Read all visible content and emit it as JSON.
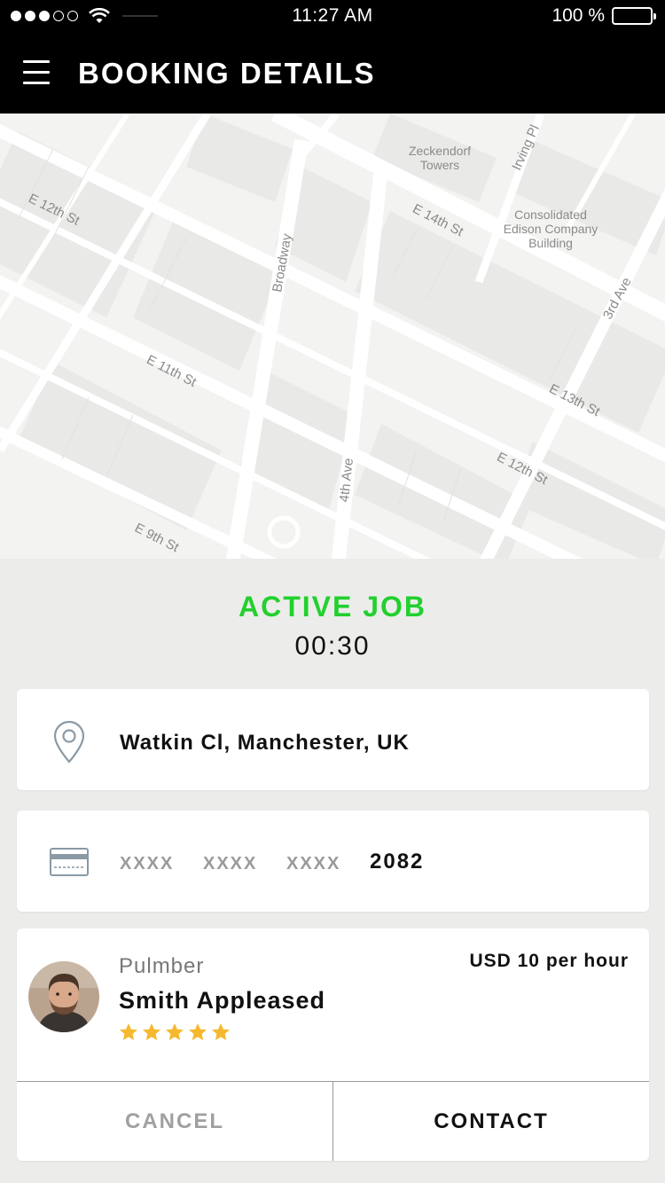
{
  "status_bar": {
    "time": "11:27 AM",
    "battery": "100 %",
    "battery_level": 1.0,
    "signal_bars_filled": 3,
    "signal_bars_total": 5
  },
  "header": {
    "title": "BOOKING DETAILS",
    "menu_icon": "hamburger-menu-icon"
  },
  "map": {
    "streets": [
      "E 12th St",
      "E 14th St",
      "Broadway",
      "Irving Pl",
      "E 11th St",
      "E 13th St",
      "E 12th St",
      "3rd Ave",
      "4th Ave",
      "E 9th St"
    ],
    "pois": [
      "Zeckendorf Towers",
      "Consolidated Edison Company Building"
    ],
    "poi_lines": {
      "zeckendorf_1": "Zeckendorf",
      "zeckendorf_2": "Towers",
      "coned_1": "Consolidated",
      "coned_2": "Edison Company",
      "coned_3": "Building"
    }
  },
  "job": {
    "status": "ACTIVE JOB",
    "timer": "00:30",
    "status_color": "#22d02e"
  },
  "address": {
    "icon": "location-pin-icon",
    "text": "Watkin Cl, Manchester, UK"
  },
  "payment": {
    "icon": "credit-card-icon",
    "masked_groups": [
      "XXXX",
      "XXXX",
      "XXXX"
    ],
    "last4": "2082"
  },
  "worker": {
    "profession": "Pulmber",
    "name": "Smith Appleased",
    "rating": 5,
    "rating_max": 5,
    "rate": "USD 10 per hour",
    "star_color": "#f5b82e"
  },
  "actions": {
    "cancel_label": "CANCEL",
    "contact_label": "CONTACT"
  }
}
